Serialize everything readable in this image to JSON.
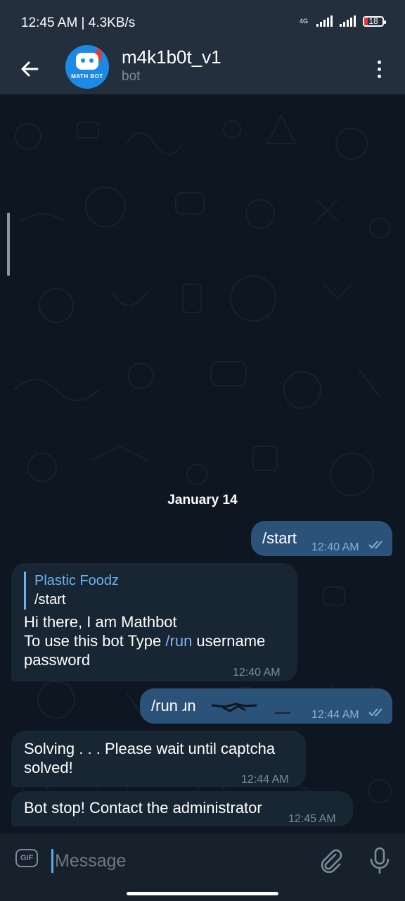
{
  "status": {
    "time_speed": "12:45 AM | 4.3KB/s",
    "network": "4G",
    "battery": "18"
  },
  "header": {
    "title": "m4k1b0t_v1",
    "subtitle": "bot",
    "avatar_text": "MATH BOT"
  },
  "chat": {
    "date": "January 14",
    "messages": [
      {
        "text": "/start",
        "time": "12:40 AM"
      },
      {
        "reply_name": "Plastic Foodz",
        "reply_text": "/start",
        "line1": "Hi there, I am Mathbot",
        "line2_pre": "To use this bot Type ",
        "line2_cmd": "/run",
        "line2_post": " username",
        "line3": "password",
        "time": "12:40 AM"
      },
      {
        "text": "/run ɹn",
        "time": "12:44 AM"
      },
      {
        "line1": "Solving . . . Please wait until captcha",
        "line2": "solved!",
        "time": "12:44 AM"
      },
      {
        "text": "Bot stop! Contact the administrator",
        "time": "12:45 AM"
      }
    ]
  },
  "input": {
    "placeholder": "Message",
    "gif_label": "GIF"
  },
  "colors": {
    "accent": "#6ab2f2",
    "outgoing_bubble": "#2b5278",
    "incoming_bubble": "#182533",
    "background": "#0e1621"
  }
}
